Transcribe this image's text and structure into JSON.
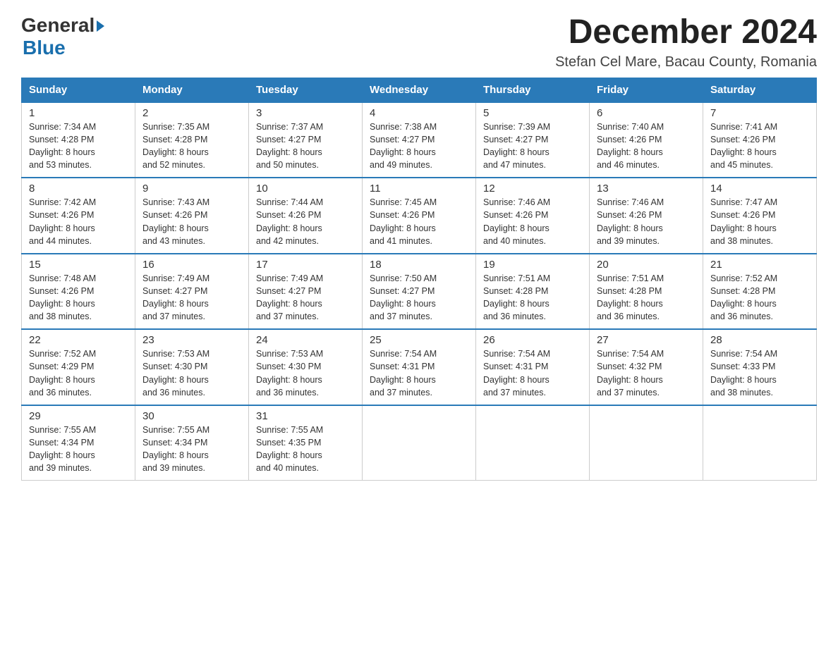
{
  "header": {
    "logo_general": "General",
    "logo_blue": "Blue",
    "month_title": "December 2024",
    "location": "Stefan Cel Mare, Bacau County, Romania"
  },
  "days_of_week": [
    "Sunday",
    "Monday",
    "Tuesday",
    "Wednesday",
    "Thursday",
    "Friday",
    "Saturday"
  ],
  "weeks": [
    [
      {
        "day": "1",
        "sunrise": "7:34 AM",
        "sunset": "4:28 PM",
        "daylight_h": "8",
        "daylight_m": "53"
      },
      {
        "day": "2",
        "sunrise": "7:35 AM",
        "sunset": "4:28 PM",
        "daylight_h": "8",
        "daylight_m": "52"
      },
      {
        "day": "3",
        "sunrise": "7:37 AM",
        "sunset": "4:27 PM",
        "daylight_h": "8",
        "daylight_m": "50"
      },
      {
        "day": "4",
        "sunrise": "7:38 AM",
        "sunset": "4:27 PM",
        "daylight_h": "8",
        "daylight_m": "49"
      },
      {
        "day": "5",
        "sunrise": "7:39 AM",
        "sunset": "4:27 PM",
        "daylight_h": "8",
        "daylight_m": "47"
      },
      {
        "day": "6",
        "sunrise": "7:40 AM",
        "sunset": "4:26 PM",
        "daylight_h": "8",
        "daylight_m": "46"
      },
      {
        "day": "7",
        "sunrise": "7:41 AM",
        "sunset": "4:26 PM",
        "daylight_h": "8",
        "daylight_m": "45"
      }
    ],
    [
      {
        "day": "8",
        "sunrise": "7:42 AM",
        "sunset": "4:26 PM",
        "daylight_h": "8",
        "daylight_m": "44"
      },
      {
        "day": "9",
        "sunrise": "7:43 AM",
        "sunset": "4:26 PM",
        "daylight_h": "8",
        "daylight_m": "43"
      },
      {
        "day": "10",
        "sunrise": "7:44 AM",
        "sunset": "4:26 PM",
        "daylight_h": "8",
        "daylight_m": "42"
      },
      {
        "day": "11",
        "sunrise": "7:45 AM",
        "sunset": "4:26 PM",
        "daylight_h": "8",
        "daylight_m": "41"
      },
      {
        "day": "12",
        "sunrise": "7:46 AM",
        "sunset": "4:26 PM",
        "daylight_h": "8",
        "daylight_m": "40"
      },
      {
        "day": "13",
        "sunrise": "7:46 AM",
        "sunset": "4:26 PM",
        "daylight_h": "8",
        "daylight_m": "39"
      },
      {
        "day": "14",
        "sunrise": "7:47 AM",
        "sunset": "4:26 PM",
        "daylight_h": "8",
        "daylight_m": "38"
      }
    ],
    [
      {
        "day": "15",
        "sunrise": "7:48 AM",
        "sunset": "4:26 PM",
        "daylight_h": "8",
        "daylight_m": "38"
      },
      {
        "day": "16",
        "sunrise": "7:49 AM",
        "sunset": "4:27 PM",
        "daylight_h": "8",
        "daylight_m": "37"
      },
      {
        "day": "17",
        "sunrise": "7:49 AM",
        "sunset": "4:27 PM",
        "daylight_h": "8",
        "daylight_m": "37"
      },
      {
        "day": "18",
        "sunrise": "7:50 AM",
        "sunset": "4:27 PM",
        "daylight_h": "8",
        "daylight_m": "37"
      },
      {
        "day": "19",
        "sunrise": "7:51 AM",
        "sunset": "4:28 PM",
        "daylight_h": "8",
        "daylight_m": "36"
      },
      {
        "day": "20",
        "sunrise": "7:51 AM",
        "sunset": "4:28 PM",
        "daylight_h": "8",
        "daylight_m": "36"
      },
      {
        "day": "21",
        "sunrise": "7:52 AM",
        "sunset": "4:28 PM",
        "daylight_h": "8",
        "daylight_m": "36"
      }
    ],
    [
      {
        "day": "22",
        "sunrise": "7:52 AM",
        "sunset": "4:29 PM",
        "daylight_h": "8",
        "daylight_m": "36"
      },
      {
        "day": "23",
        "sunrise": "7:53 AM",
        "sunset": "4:30 PM",
        "daylight_h": "8",
        "daylight_m": "36"
      },
      {
        "day": "24",
        "sunrise": "7:53 AM",
        "sunset": "4:30 PM",
        "daylight_h": "8",
        "daylight_m": "36"
      },
      {
        "day": "25",
        "sunrise": "7:54 AM",
        "sunset": "4:31 PM",
        "daylight_h": "8",
        "daylight_m": "37"
      },
      {
        "day": "26",
        "sunrise": "7:54 AM",
        "sunset": "4:31 PM",
        "daylight_h": "8",
        "daylight_m": "37"
      },
      {
        "day": "27",
        "sunrise": "7:54 AM",
        "sunset": "4:32 PM",
        "daylight_h": "8",
        "daylight_m": "37"
      },
      {
        "day": "28",
        "sunrise": "7:54 AM",
        "sunset": "4:33 PM",
        "daylight_h": "8",
        "daylight_m": "38"
      }
    ],
    [
      {
        "day": "29",
        "sunrise": "7:55 AM",
        "sunset": "4:34 PM",
        "daylight_h": "8",
        "daylight_m": "39"
      },
      {
        "day": "30",
        "sunrise": "7:55 AM",
        "sunset": "4:34 PM",
        "daylight_h": "8",
        "daylight_m": "39"
      },
      {
        "day": "31",
        "sunrise": "7:55 AM",
        "sunset": "4:35 PM",
        "daylight_h": "8",
        "daylight_m": "40"
      },
      null,
      null,
      null,
      null
    ]
  ],
  "labels": {
    "sunrise": "Sunrise:",
    "sunset": "Sunset:",
    "daylight": "Daylight: 8 hours"
  }
}
